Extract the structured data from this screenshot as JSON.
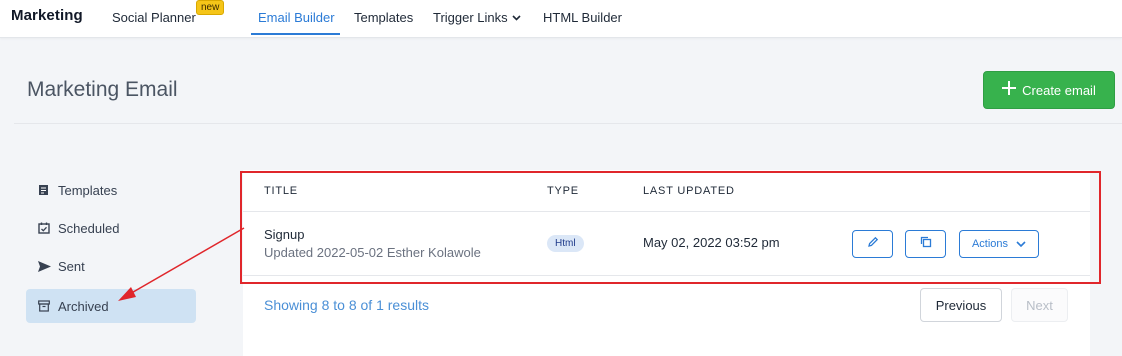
{
  "nav": {
    "brand": "Marketing",
    "items": [
      {
        "label": "Social Planner",
        "badge": "new"
      },
      {
        "label": "Email Builder",
        "active": true
      },
      {
        "label": "Templates"
      },
      {
        "label": "Trigger Links",
        "has_dropdown": true
      },
      {
        "label": "HTML Builder"
      }
    ]
  },
  "header": {
    "title": "Marketing Email",
    "create_label": "Create email"
  },
  "sidebar": {
    "items": [
      {
        "label": "Templates",
        "icon": "edit-document-icon"
      },
      {
        "label": "Scheduled",
        "icon": "calendar-check-icon"
      },
      {
        "label": "Sent",
        "icon": "send-icon"
      },
      {
        "label": "Archived",
        "icon": "archive-box-icon",
        "active": true
      }
    ]
  },
  "table": {
    "columns": [
      "TITLE",
      "TYPE",
      "LAST UPDATED"
    ],
    "rows": [
      {
        "title": "Signup",
        "subtitle": "Updated 2022-05-02 Esther Kolawole",
        "type": "Html",
        "last_updated": "May 02, 2022 03:52 pm",
        "actions_label": "Actions"
      }
    ]
  },
  "pagination": {
    "summary": "Showing 8 to 8 of 1 results",
    "previous": "Previous",
    "next": "Next"
  },
  "colors": {
    "accent": "#2b7bd6",
    "create_button": "#37b24d",
    "annotation": "#e0262b",
    "active_sidebar": "#cfe2f3"
  }
}
